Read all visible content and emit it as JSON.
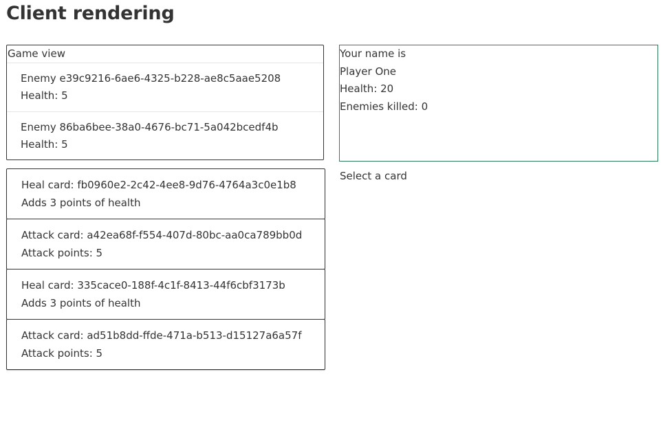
{
  "page": {
    "title": "Client rendering"
  },
  "game_view": {
    "label": "Game view",
    "enemies": [
      {
        "title": "Enemy e39c9216-6ae6-4325-b228-ae8c5aae5208",
        "health": "Health: 5"
      },
      {
        "title": "Enemy 86ba6bee-38a0-4676-bc71-5a042bcedf4b",
        "health": "Health: 5"
      }
    ]
  },
  "player": {
    "name_label": "Your name is",
    "name": "Player One",
    "health": "Health: 20",
    "kills": "Enemies killed: 0"
  },
  "cards": [
    {
      "title": "Heal card: fb0960e2-2c42-4ee8-9d76-4764a3c0e1b8",
      "detail": "Adds 3 points of health"
    },
    {
      "title": "Attack card: a42ea68f-f554-407d-80bc-aa0ca789bb0d",
      "detail": "Attack points: 5"
    },
    {
      "title": "Heal card: 335cace0-188f-4c1f-8413-44f6cbf3173b",
      "detail": "Adds 3 points of health"
    },
    {
      "title": "Attack card: ad51b8dd-ffde-471a-b513-d15127a6a57f",
      "detail": "Attack points: 5"
    }
  ],
  "select_prompt": "Select a card",
  "colors": {
    "text": "#333333",
    "player_panel_border": "#2e7d5a",
    "card_border": "#333333"
  }
}
